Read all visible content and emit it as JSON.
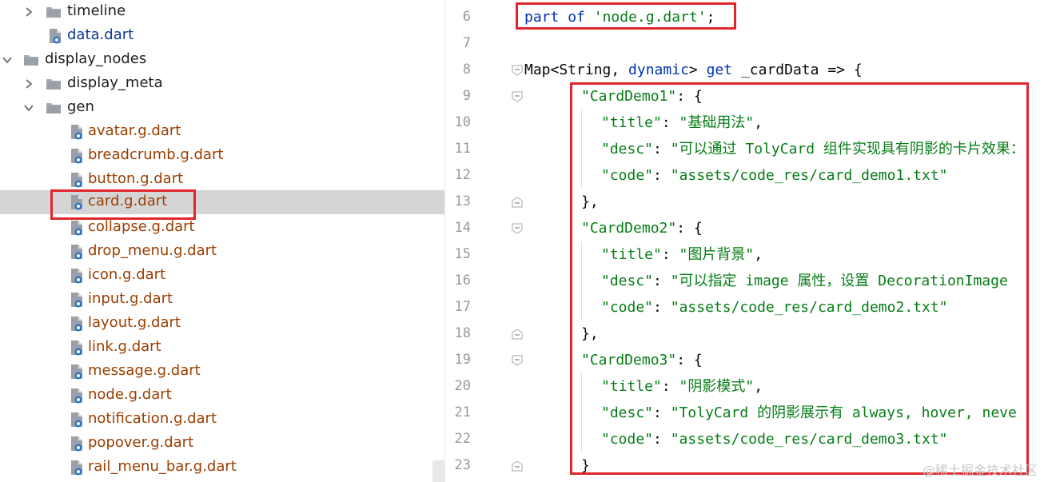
{
  "tree": {
    "items": [
      {
        "label": "timeline",
        "kind": "folder",
        "expanded": false
      },
      {
        "label": "data.dart",
        "kind": "dart-blue"
      },
      {
        "label": "display_nodes",
        "kind": "folder",
        "expanded": true
      },
      {
        "label": "display_meta",
        "kind": "folder",
        "expanded": false
      },
      {
        "label": "gen",
        "kind": "folder",
        "expanded": true
      },
      {
        "label": "avatar.g.dart",
        "kind": "dart"
      },
      {
        "label": "breadcrumb.g.dart",
        "kind": "dart"
      },
      {
        "label": "button.g.dart",
        "kind": "dart"
      },
      {
        "label": "card.g.dart",
        "kind": "dart",
        "selected": true
      },
      {
        "label": "collapse.g.dart",
        "kind": "dart"
      },
      {
        "label": "drop_menu.g.dart",
        "kind": "dart"
      },
      {
        "label": "icon.g.dart",
        "kind": "dart"
      },
      {
        "label": "input.g.dart",
        "kind": "dart"
      },
      {
        "label": "layout.g.dart",
        "kind": "dart"
      },
      {
        "label": "link.g.dart",
        "kind": "dart"
      },
      {
        "label": "message.g.dart",
        "kind": "dart"
      },
      {
        "label": "node.g.dart",
        "kind": "dart"
      },
      {
        "label": "notification.g.dart",
        "kind": "dart"
      },
      {
        "label": "popover.g.dart",
        "kind": "dart"
      },
      {
        "label": "rail_menu_bar.g.dart",
        "kind": "dart"
      }
    ]
  },
  "editor": {
    "line_numbers": [
      "6",
      "7",
      "8",
      "9",
      "10",
      "11",
      "12",
      "13",
      "14",
      "15",
      "16",
      "17",
      "18",
      "19",
      "20",
      "21",
      "22",
      "23"
    ],
    "lines": {
      "l6": {
        "kw1": "part",
        "kw2": "of",
        "str": "'node.g.dart'",
        "semi": ";"
      },
      "l8": {
        "type1": "Map<String, ",
        "kw": "dynamic",
        "mid": "> ",
        "get": "get",
        "rest": " _cardData => {"
      },
      "l9": {
        "key": "\"CardDemo1\"",
        "rest": ": {"
      },
      "l10": {
        "key": "\"title\"",
        "sep": ": ",
        "val": "\"基础用法\"",
        "end": ","
      },
      "l11": {
        "key": "\"desc\"",
        "sep": ": ",
        "val": "\"可以通过 TolyCard 组件实现具有阴影的卡片效果："
      },
      "l12": {
        "key": "\"code\"",
        "sep": ": ",
        "val": "\"assets/code_res/card_demo1.txt\""
      },
      "l13": {
        "text": "},"
      },
      "l14": {
        "key": "\"CardDemo2\"",
        "rest": ": {"
      },
      "l15": {
        "key": "\"title\"",
        "sep": ": ",
        "val": "\"图片背景\"",
        "end": ","
      },
      "l16": {
        "key": "\"desc\"",
        "sep": ": ",
        "val": "\"可以指定 image 属性，设置 DecorationImage"
      },
      "l17": {
        "key": "\"code\"",
        "sep": ": ",
        "val": "\"assets/code_res/card_demo2.txt\""
      },
      "l18": {
        "text": "},"
      },
      "l19": {
        "key": "\"CardDemo3\"",
        "rest": ": {"
      },
      "l20": {
        "key": "\"title\"",
        "sep": ": ",
        "val": "\"阴影模式\"",
        "end": ","
      },
      "l21": {
        "key": "\"desc\"",
        "sep": ": ",
        "val": "\"TolyCard 的阴影展示有 always, hover, neve"
      },
      "l22": {
        "key": "\"code\"",
        "sep": ": ",
        "val": "\"assets/code_res/card_demo3.txt\""
      },
      "l23": {
        "text": "}"
      }
    }
  },
  "watermark": "@稀土掘金技术社区",
  "colors": {
    "highlight_box": "#e0262b",
    "keyword": "#0033b3",
    "string": "#067d17",
    "dart_file": "#9b3e00",
    "selected_row": "#d5d5d5"
  }
}
